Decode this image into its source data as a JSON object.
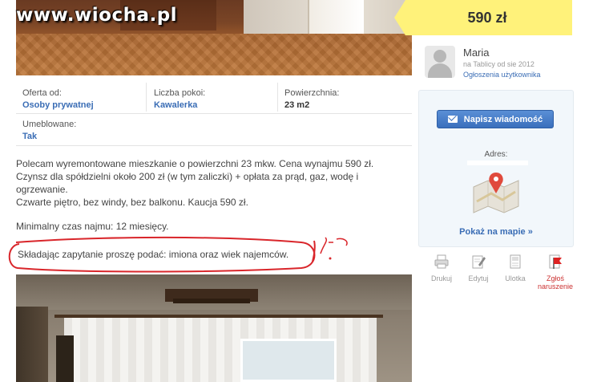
{
  "watermark": "www.wiocha.pl",
  "price": "590 zł",
  "user": {
    "name": "Maria",
    "since": "na Tablicy od sie 2012",
    "ads_link": "Ogłoszenia użytkownika"
  },
  "contact": {
    "message_button": "Napisz wiadomość",
    "address_label": "Adres:",
    "map_link": "Pokaż na mapie »"
  },
  "actions": [
    {
      "label": "Drukuj",
      "icon": "printer-icon"
    },
    {
      "label": "Edytuj",
      "icon": "edit-icon"
    },
    {
      "label": "Ulotka",
      "icon": "flyer-icon"
    },
    {
      "label": "Zgłoś naruszenie",
      "icon": "flag-icon"
    }
  ],
  "details": {
    "offer_from": {
      "label": "Oferta od:",
      "value": "Osoby prywatnej"
    },
    "rooms": {
      "label": "Liczba pokoi:",
      "value": "Kawalerka"
    },
    "area": {
      "label": "Powierzchnia:",
      "value": "23 m2"
    },
    "furnished": {
      "label": "Umeblowane:",
      "value": "Tak"
    }
  },
  "description": {
    "line1": "Polecam wyremontowane mieszkanie o powierzchni 23 mkw. Cena wynajmu 590 zł.",
    "line2": "Czynsz dla spółdzielni około 200 zł (w tym zaliczki) + opłata za prąd, gaz, wodę i",
    "line3": "ogrzewanie.",
    "line4": "Czwarte piętro, bez windy, bez balkonu. Kaucja 590 zł.",
    "line5": "Minimalny czas najmu: 12 miesięcy.",
    "circled": "Składając zapytanie proszę podać: imiona oraz wiek najemców."
  },
  "colors": {
    "accent": "#3a6db5",
    "price_bg": "#fff27a",
    "annotation": "#d9262b",
    "report": "#cc3333"
  }
}
